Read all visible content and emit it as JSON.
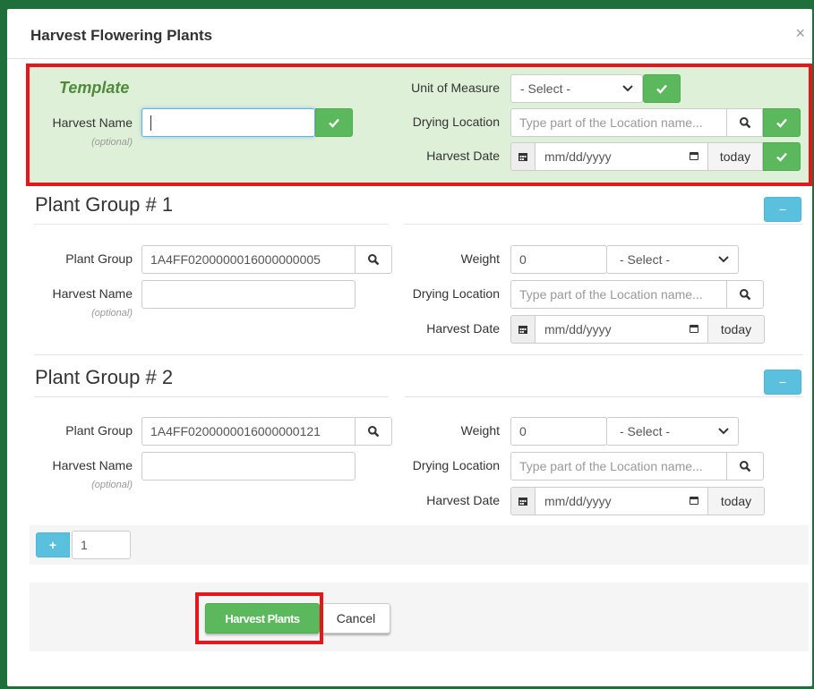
{
  "dialog": {
    "title": "Harvest Flowering Plants",
    "close_glyph": "×"
  },
  "template": {
    "heading": "Template",
    "harvest_name_label": "Harvest Name",
    "optional_label": "(optional)",
    "harvest_name_value": "",
    "unit_of_measure_label": "Unit of Measure",
    "unit_of_measure_value": "- Select -",
    "drying_location_label": "Drying Location",
    "drying_location_placeholder": "Type part of the Location name...",
    "harvest_date_label": "Harvest Date",
    "harvest_date_placeholder": "mm/dd/yyyy",
    "today_label": "today"
  },
  "groups": [
    {
      "title": "Plant Group # 1",
      "minus_label": "−",
      "plant_group_label": "Plant Group",
      "plant_group_value": "1A4FF0200000016000000005",
      "harvest_name_label": "Harvest Name",
      "optional_label": "(optional)",
      "harvest_name_value": "",
      "weight_label": "Weight",
      "weight_value": "0",
      "unit_value": "- Select -",
      "drying_location_label": "Drying Location",
      "drying_location_placeholder": "Type part of the Location name...",
      "harvest_date_label": "Harvest Date",
      "harvest_date_placeholder": "mm/dd/yyyy",
      "today_label": "today"
    },
    {
      "title": "Plant Group # 2",
      "minus_label": "−",
      "plant_group_label": "Plant Group",
      "plant_group_value": "1A4FF0200000016000000121",
      "harvest_name_label": "Harvest Name",
      "optional_label": "(optional)",
      "harvest_name_value": "",
      "weight_label": "Weight",
      "weight_value": "0",
      "unit_value": "- Select -",
      "drying_location_label": "Drying Location",
      "drying_location_placeholder": "Type part of the Location name...",
      "harvest_date_label": "Harvest Date",
      "harvest_date_placeholder": "mm/dd/yyyy",
      "today_label": "today"
    }
  ],
  "add_row": {
    "plus_label": "+",
    "count_value": "1"
  },
  "footer": {
    "harvest_button": "Harvest Plants",
    "cancel_button": "Cancel"
  },
  "colors": {
    "highlight_red": "#e8151b",
    "template_bg": "#dff0d8",
    "success_green": "#5cb85c",
    "info_blue": "#5bc0de"
  }
}
